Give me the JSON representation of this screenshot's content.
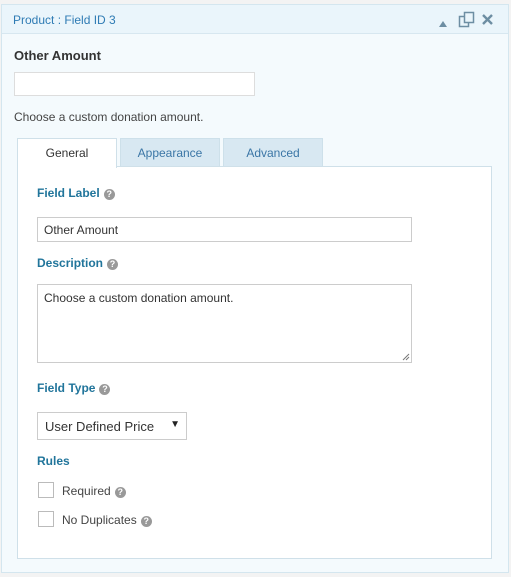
{
  "header": {
    "title": "Product : Field ID 3",
    "icons": [
      "collapse-icon",
      "duplicate-icon",
      "delete-icon"
    ]
  },
  "preview": {
    "label": "Other Amount",
    "input_value": "",
    "description": "Choose a custom donation amount."
  },
  "tabs": [
    {
      "label": "General",
      "active": true
    },
    {
      "label": "Appearance",
      "active": false
    },
    {
      "label": "Advanced",
      "active": false
    }
  ],
  "settings": {
    "field_label": {
      "label": "Field Label",
      "help": "?",
      "value": "Other Amount"
    },
    "description": {
      "label": "Description",
      "help": "?",
      "value": "Choose a custom donation amount."
    },
    "field_type": {
      "label": "Field Type",
      "help": "?",
      "selected": "User Defined Price"
    },
    "rules": {
      "label": "Rules",
      "options": [
        {
          "label": "Required",
          "checked": false,
          "help": "?"
        },
        {
          "label": "No Duplicates",
          "checked": false,
          "help": "?"
        }
      ]
    }
  },
  "colors": {
    "accent": "#21759b",
    "header_bg": "#eaf5fb",
    "tab_inactive_bg": "#d8e8f2"
  }
}
